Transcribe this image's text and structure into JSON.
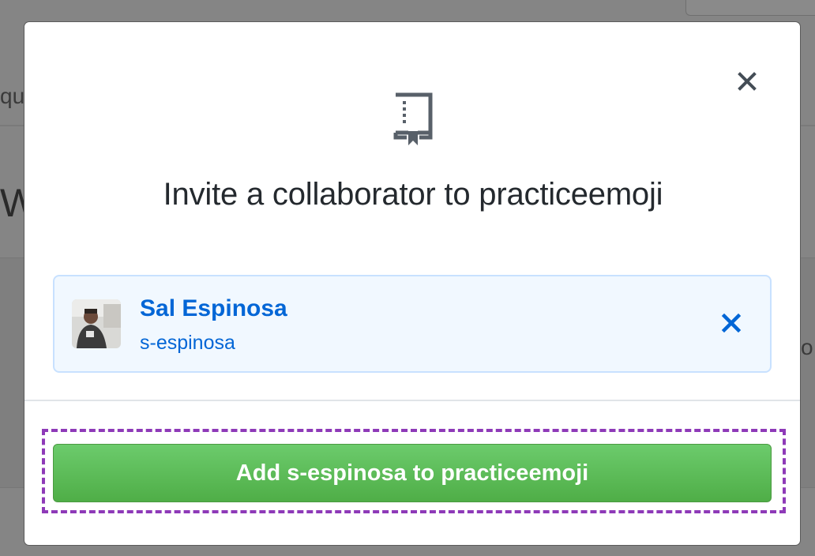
{
  "background": {
    "fragment_left_top": "qu",
    "fragment_left_large": "W",
    "fragment_right": "o"
  },
  "modal": {
    "title": "Invite a collaborator to practiceemoji",
    "icon": "repo-icon",
    "close_icon": "close-icon",
    "selected_user": {
      "name": "Sal Espinosa",
      "login": "s-espinosa",
      "remove_icon": "remove-user-icon"
    },
    "submit_label": "Add s-espinosa to practiceemoji"
  },
  "colors": {
    "link_blue": "#0366d6",
    "card_background": "#f1f8ff",
    "button_green": "#4fae47",
    "highlight_purple": "#8e3ab8"
  }
}
